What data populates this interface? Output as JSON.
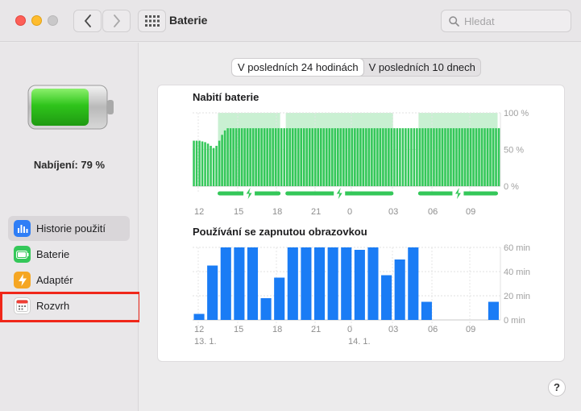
{
  "window": {
    "title": "Baterie",
    "search_placeholder": "Hledat",
    "help_label": "?"
  },
  "sidebar": {
    "charge_label": "Nabíjení: 79 %",
    "battery_level_percent": 79,
    "items": [
      {
        "label": "Historie použití",
        "icon": "bar-chart-icon",
        "color": "#2f7ef6",
        "active": true
      },
      {
        "label": "Baterie",
        "icon": "battery-icon",
        "color": "#34c759",
        "active": false
      },
      {
        "label": "Adaptér",
        "icon": "lightning-icon",
        "color": "#f5a623",
        "active": false
      },
      {
        "label": "Rozvrh",
        "icon": "calendar-icon",
        "color": "#ffffff",
        "active": false
      }
    ]
  },
  "segments": {
    "options": [
      "V posledních 24 hodinách",
      "V posledních 10 dnech"
    ],
    "selected": 0
  },
  "colors": {
    "battery_green": "#34c759",
    "battery_green_bg": "#c9f0d2",
    "screen_blue": "#1a7cf5",
    "highlight_red": "#f0271a"
  },
  "chart_data": [
    {
      "type": "bar",
      "title": "Nabití baterie",
      "x_tick_labels": [
        "12",
        "15",
        "18",
        "21",
        "0",
        "03",
        "06",
        "09"
      ],
      "ylim": [
        0,
        100
      ],
      "y_tick_labels": [
        "100 %",
        "50 %",
        "0 %"
      ],
      "unit": "%",
      "values": [
        62,
        62,
        62,
        61,
        60,
        58,
        55,
        52,
        55,
        62,
        70,
        76,
        79,
        79,
        79,
        79,
        79,
        79,
        79,
        79,
        79,
        79,
        79,
        79,
        79,
        79,
        79,
        79,
        79,
        79,
        79,
        79,
        79,
        79,
        79,
        79,
        79,
        79,
        79,
        79,
        79,
        79,
        79,
        79,
        79,
        79,
        79,
        79,
        79,
        79,
        79,
        79,
        79,
        79,
        79,
        79,
        79,
        79,
        79,
        79,
        79,
        79,
        79,
        79,
        79,
        79,
        79,
        79,
        79,
        79,
        79,
        79,
        79,
        79,
        79,
        79,
        79,
        79,
        79,
        79,
        79,
        79,
        79,
        79,
        79,
        79,
        79,
        79,
        79,
        79,
        79,
        79,
        79,
        79,
        79,
        79,
        79,
        79,
        79,
        79,
        79,
        79,
        79,
        79,
        79,
        79,
        79,
        79,
        79
      ],
      "charging_ranges_bars": [
        [
          9,
          31
        ],
        [
          33,
          71
        ],
        [
          80,
          108
        ]
      ],
      "grid": true
    },
    {
      "type": "bar",
      "title": "Používání se zapnutou obrazovkou",
      "x_tick_labels": [
        "12",
        "15",
        "18",
        "21",
        "0",
        "03",
        "06",
        "09"
      ],
      "date_labels": [
        "13. 1.",
        "14. 1."
      ],
      "ylim": [
        0,
        60
      ],
      "y_tick_labels": [
        "60 min",
        "40 min",
        "20 min",
        "0 min"
      ],
      "unit": "min",
      "values": [
        5,
        45,
        60,
        60,
        60,
        18,
        35,
        60,
        60,
        60,
        60,
        60,
        58,
        60,
        37,
        50,
        60,
        15,
        0,
        0,
        0,
        0,
        15
      ],
      "grid": true
    }
  ]
}
